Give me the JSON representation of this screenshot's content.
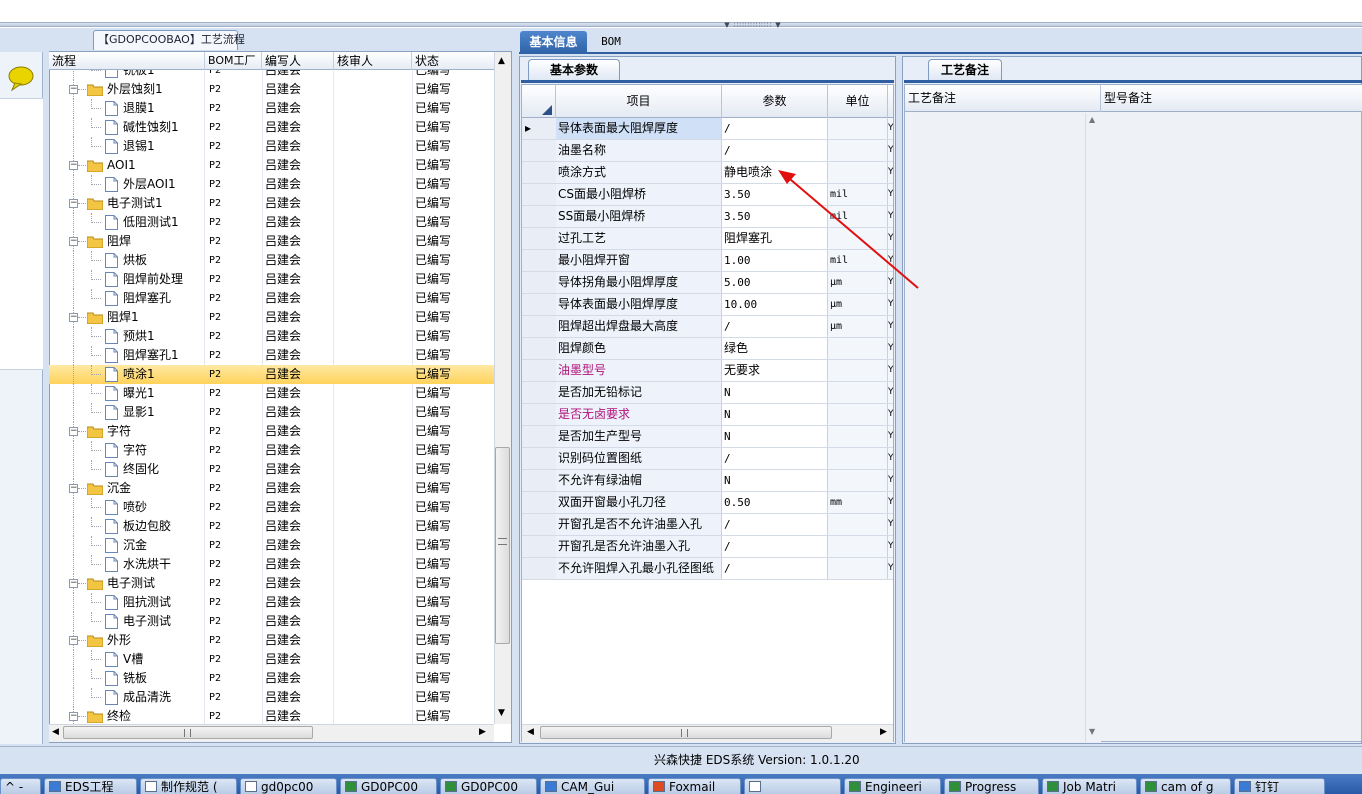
{
  "process_panel": {
    "title": "【GDOPCOOBAO】工艺流程",
    "columns": [
      "流程",
      "BOM工厂",
      "编写人",
      "核审人",
      "状态"
    ],
    "rows": [
      {
        "level": 1,
        "label": "铣板1",
        "factory": "P2",
        "writer": "吕建会",
        "reviewer": "",
        "status": "已编写",
        "partial": true
      },
      {
        "level": 0,
        "label": "外层蚀刻1",
        "factory": "P2",
        "writer": "吕建会",
        "reviewer": "",
        "status": "已编写"
      },
      {
        "level": 1,
        "label": "退膜1",
        "factory": "P2",
        "writer": "吕建会",
        "reviewer": "",
        "status": "已编写"
      },
      {
        "level": 1,
        "label": "碱性蚀刻1",
        "factory": "P2",
        "writer": "吕建会",
        "reviewer": "",
        "status": "已编写"
      },
      {
        "level": 1,
        "label": "退锡1",
        "factory": "P2",
        "writer": "吕建会",
        "reviewer": "",
        "status": "已编写"
      },
      {
        "level": 0,
        "label": "AOI1",
        "factory": "P2",
        "writer": "吕建会",
        "reviewer": "",
        "status": "已编写"
      },
      {
        "level": 1,
        "label": "外层AOI1",
        "factory": "P2",
        "writer": "吕建会",
        "reviewer": "",
        "status": "已编写"
      },
      {
        "level": 0,
        "label": "电子测试1",
        "factory": "P2",
        "writer": "吕建会",
        "reviewer": "",
        "status": "已编写"
      },
      {
        "level": 1,
        "label": "低阻测试1",
        "factory": "P2",
        "writer": "吕建会",
        "reviewer": "",
        "status": "已编写"
      },
      {
        "level": 0,
        "label": "阻焊",
        "factory": "P2",
        "writer": "吕建会",
        "reviewer": "",
        "status": "已编写"
      },
      {
        "level": 1,
        "label": "烘板",
        "factory": "P2",
        "writer": "吕建会",
        "reviewer": "",
        "status": "已编写"
      },
      {
        "level": 1,
        "label": "阻焊前处理",
        "factory": "P2",
        "writer": "吕建会",
        "reviewer": "",
        "status": "已编写"
      },
      {
        "level": 1,
        "label": "阻焊塞孔",
        "factory": "P2",
        "writer": "吕建会",
        "reviewer": "",
        "status": "已编写"
      },
      {
        "level": 0,
        "label": "阻焊1",
        "factory": "P2",
        "writer": "吕建会",
        "reviewer": "",
        "status": "已编写"
      },
      {
        "level": 1,
        "label": "预烘1",
        "factory": "P2",
        "writer": "吕建会",
        "reviewer": "",
        "status": "已编写"
      },
      {
        "level": 1,
        "label": "阻焊塞孔1",
        "factory": "P2",
        "writer": "吕建会",
        "reviewer": "",
        "status": "已编写"
      },
      {
        "level": 1,
        "label": "喷涂1",
        "factory": "P2",
        "writer": "吕建会",
        "reviewer": "",
        "status": "已编写",
        "selected": true
      },
      {
        "level": 1,
        "label": "曝光1",
        "factory": "P2",
        "writer": "吕建会",
        "reviewer": "",
        "status": "已编写"
      },
      {
        "level": 1,
        "label": "显影1",
        "factory": "P2",
        "writer": "吕建会",
        "reviewer": "",
        "status": "已编写"
      },
      {
        "level": 0,
        "label": "字符",
        "factory": "P2",
        "writer": "吕建会",
        "reviewer": "",
        "status": "已编写"
      },
      {
        "level": 1,
        "label": "字符",
        "factory": "P2",
        "writer": "吕建会",
        "reviewer": "",
        "status": "已编写"
      },
      {
        "level": 1,
        "label": "终固化",
        "factory": "P2",
        "writer": "吕建会",
        "reviewer": "",
        "status": "已编写"
      },
      {
        "level": 0,
        "label": "沉金",
        "factory": "P2",
        "writer": "吕建会",
        "reviewer": "",
        "status": "已编写"
      },
      {
        "level": 1,
        "label": "喷砂",
        "factory": "P2",
        "writer": "吕建会",
        "reviewer": "",
        "status": "已编写"
      },
      {
        "level": 1,
        "label": "板边包胶",
        "factory": "P2",
        "writer": "吕建会",
        "reviewer": "",
        "status": "已编写"
      },
      {
        "level": 1,
        "label": "沉金",
        "factory": "P2",
        "writer": "吕建会",
        "reviewer": "",
        "status": "已编写"
      },
      {
        "level": 1,
        "label": "水洗烘干",
        "factory": "P2",
        "writer": "吕建会",
        "reviewer": "",
        "status": "已编写"
      },
      {
        "level": 0,
        "label": "电子测试",
        "factory": "P2",
        "writer": "吕建会",
        "reviewer": "",
        "status": "已编写"
      },
      {
        "level": 1,
        "label": "阻抗测试",
        "factory": "P2",
        "writer": "吕建会",
        "reviewer": "",
        "status": "已编写"
      },
      {
        "level": 1,
        "label": "电子测试",
        "factory": "P2",
        "writer": "吕建会",
        "reviewer": "",
        "status": "已编写"
      },
      {
        "level": 0,
        "label": "外形",
        "factory": "P2",
        "writer": "吕建会",
        "reviewer": "",
        "status": "已编写"
      },
      {
        "level": 1,
        "label": "V槽",
        "factory": "P2",
        "writer": "吕建会",
        "reviewer": "",
        "status": "已编写"
      },
      {
        "level": 1,
        "label": "铣板",
        "factory": "P2",
        "writer": "吕建会",
        "reviewer": "",
        "status": "已编写"
      },
      {
        "level": 1,
        "label": "成品清洗",
        "factory": "P2",
        "writer": "吕建会",
        "reviewer": "",
        "status": "已编写"
      },
      {
        "level": 0,
        "label": "终检",
        "factory": "P2",
        "writer": "吕建会",
        "reviewer": "",
        "status": "已编写"
      }
    ]
  },
  "tabs": {
    "basic": "基本信息",
    "bom": "BOM"
  },
  "param_panel": {
    "tab": "基本参数",
    "columns": [
      "项目",
      "参数",
      "单位"
    ],
    "extra_col_glyph": "Y",
    "rows": [
      {
        "name": "导体表面最大阻焊厚度",
        "value": "/",
        "unit": "",
        "current": true
      },
      {
        "name": "油墨名称",
        "value": "/",
        "unit": ""
      },
      {
        "name": "喷涂方式",
        "value": "静电喷涂",
        "unit": ""
      },
      {
        "name": "CS面最小阻焊桥",
        "value": "3.50",
        "unit": "mil"
      },
      {
        "name": "SS面最小阻焊桥",
        "value": "3.50",
        "unit": "mil"
      },
      {
        "name": "过孔工艺",
        "value": "阻焊塞孔",
        "unit": ""
      },
      {
        "name": "最小阻焊开窗",
        "value": "1.00",
        "unit": "mil"
      },
      {
        "name": "导体拐角最小阻焊厚度",
        "value": "5.00",
        "unit": "μm"
      },
      {
        "name": "导体表面最小阻焊厚度",
        "value": "10.00",
        "unit": "μm"
      },
      {
        "name": "阻焊超出焊盘最大高度",
        "value": "/",
        "unit": "μm"
      },
      {
        "name": "阻焊颜色",
        "value": "绿色",
        "unit": ""
      },
      {
        "name": "油墨型号",
        "value": "无要求",
        "unit": "",
        "highlight": true
      },
      {
        "name": "是否加无铅标记",
        "value": "N",
        "unit": ""
      },
      {
        "name": "是否无卤要求",
        "value": "N",
        "unit": "",
        "highlight": true
      },
      {
        "name": "是否加生产型号",
        "value": "N",
        "unit": ""
      },
      {
        "name": "识别码位置图纸",
        "value": "/",
        "unit": ""
      },
      {
        "name": "不允许有绿油帽",
        "value": "N",
        "unit": ""
      },
      {
        "name": "双面开窗最小孔刀径",
        "value": "0.50",
        "unit": "mm"
      },
      {
        "name": "开窗孔是否不允许油墨入孔",
        "value": "/",
        "unit": ""
      },
      {
        "name": "开窗孔是否允许油墨入孔",
        "value": "/",
        "unit": ""
      },
      {
        "name": "不允许阻焊入孔最小孔径图纸",
        "value": "/",
        "unit": ""
      }
    ]
  },
  "remark_panel": {
    "tab": "工艺备注",
    "col1": "工艺备注",
    "col2": "型号备注"
  },
  "status_text": "兴森快捷 EDS系统 Version: 1.0.1.20",
  "taskbar": [
    {
      "label": "^ -",
      "icon": "none"
    },
    {
      "label": "EDS工程",
      "icon": "app-icon"
    },
    {
      "label": "制作规范 (",
      "icon": "doc-icon"
    },
    {
      "label": "gd0pc00",
      "icon": "doc-icon"
    },
    {
      "label": "GD0PC00",
      "icon": "excel-icon"
    },
    {
      "label": "GD0PC00",
      "icon": "excel-icon"
    },
    {
      "label": "CAM_Gui",
      "icon": "app-icon"
    },
    {
      "label": "Foxmail",
      "icon": "mail-icon"
    },
    {
      "label": "",
      "icon": "window-icon"
    },
    {
      "label": "Engineeri",
      "icon": "excel-icon"
    },
    {
      "label": "Progress",
      "icon": "excel-icon"
    },
    {
      "label": "Job Matri",
      "icon": "excel-icon"
    },
    {
      "label": "cam of g",
      "icon": "excel-icon"
    },
    {
      "label": "钉钉",
      "icon": "app-icon"
    }
  ]
}
